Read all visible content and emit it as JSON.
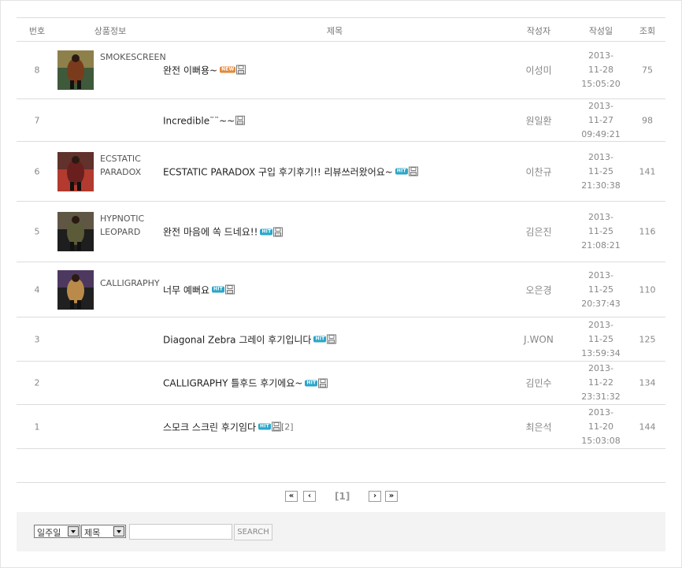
{
  "header": {
    "num": "번호",
    "product": "상품정보",
    "title": "제목",
    "author": "작성자",
    "date": "작성일",
    "views": "조회"
  },
  "rows": [
    {
      "num": "8",
      "product": "SMOKESCREEN",
      "title": "완전 이뻐용~",
      "badge": "NEW",
      "author": "이성미",
      "date": "2013-11-28\n15:05:20",
      "views": "75"
    },
    {
      "num": "7",
      "product": "",
      "title": "Incredible¨¨~~",
      "badge": "",
      "author": "원일환",
      "date": "2013-11-27\n09:49:21",
      "views": "98"
    },
    {
      "num": "6",
      "product": "ECSTATIC\nPARADOX",
      "title": "ECSTATIC PARADOX 구입 후기후기!! 리뷰쓰러왔어요~",
      "badge": "HIT",
      "author": "이찬규",
      "date": "2013-11-25\n21:30:38",
      "views": "141"
    },
    {
      "num": "5",
      "product": "HYPNOTIC\nLEOPARD",
      "title": "완전 마음에 쏙 드네요!!",
      "badge": "HIT",
      "author": "김은진",
      "date": "2013-11-25\n21:08:21",
      "views": "116"
    },
    {
      "num": "4",
      "product": "CALLIGRAPHY",
      "title": "너무 예뻐요",
      "badge": "HIT",
      "author": "오은경",
      "date": "2013-11-25\n20:37:43",
      "views": "110"
    },
    {
      "num": "3",
      "product": "",
      "title": "Diagonal Zebra 그레이 후기입니다",
      "badge": "HIT",
      "author": "J.WON",
      "date": "2013-11-25\n13:59:34",
      "views": "125"
    },
    {
      "num": "2",
      "product": "",
      "title": "CALLIGRAPHY 틀후드 후기에요~",
      "badge": "HIT",
      "author": "김민수",
      "date": "2013-11-22\n23:31:32",
      "views": "134"
    },
    {
      "num": "1",
      "product": "",
      "title": "스모크 스크린 후기임다",
      "badge": "HIT",
      "author": "최은석",
      "date": "2013-11-20\n15:03:08",
      "views": "144",
      "comments": "[2]"
    }
  ],
  "pager": {
    "first": "«",
    "prev": "‹",
    "current": "[1]",
    "next": "›",
    "last": "»"
  },
  "search": {
    "period": "일주일",
    "field": "제목",
    "query": "",
    "button": "SEARCH"
  },
  "icons": {
    "attachment": "floppy-disk-icon"
  }
}
